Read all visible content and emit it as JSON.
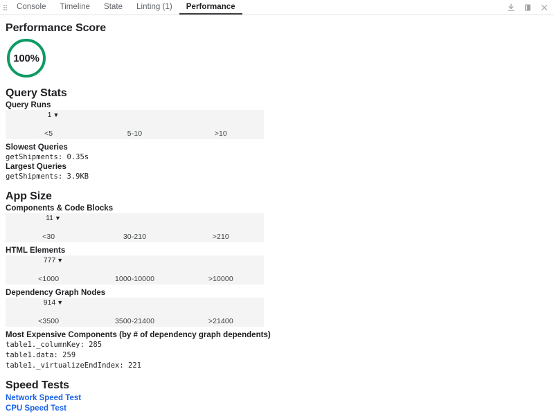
{
  "toolbar": {
    "drag_handle_icon": "drag-dots-icon",
    "tabs": [
      {
        "label": "Console",
        "active": false
      },
      {
        "label": "Timeline",
        "active": false
      },
      {
        "label": "State",
        "active": false
      },
      {
        "label": "Linting (1)",
        "active": false
      },
      {
        "label": "Performance",
        "active": true
      }
    ],
    "actions": [
      {
        "name": "download-icon",
        "title": "Download"
      },
      {
        "name": "dock-panel-icon",
        "title": "Dock panel"
      },
      {
        "name": "close-icon",
        "title": "Close"
      }
    ]
  },
  "performance_score": {
    "heading": "Performance Score",
    "value": "100%",
    "ring_color": "#0c9b63"
  },
  "query_stats": {
    "heading": "Query Stats",
    "gauge": {
      "label": "Query Runs",
      "marker_value": "1",
      "marker_percent": 18.5,
      "ranges": [
        "<5",
        "5-10",
        ">10"
      ]
    },
    "slowest_queries": {
      "label": "Slowest Queries",
      "items": [
        "getShipments: 0.35s"
      ]
    },
    "largest_queries": {
      "label": "Largest Queries",
      "items": [
        "getShipments: 3.9KB"
      ]
    }
  },
  "app_size": {
    "heading": "App Size",
    "gauges": [
      {
        "label": "Components & Code Blocks",
        "marker_value": "11",
        "marker_percent": 18.5,
        "ranges": [
          "<30",
          "30-210",
          ">210"
        ]
      },
      {
        "label": "HTML Elements",
        "marker_value": "777",
        "marker_percent": 18.5,
        "ranges": [
          "<1000",
          "1000-10000",
          ">10000"
        ]
      },
      {
        "label": "Dependency Graph Nodes",
        "marker_value": "914",
        "marker_percent": 18.5,
        "ranges": [
          "<3500",
          "3500-21400",
          ">21400"
        ]
      }
    ],
    "expensive_components": {
      "label": "Most Expensive Components (by # of dependency graph dependents)",
      "items": [
        "table1._columnKey: 285",
        "table1.data: 259",
        "table1._virtualizeEndIndex: 221"
      ]
    }
  },
  "speed_tests": {
    "heading": "Speed Tests",
    "links": [
      "Network Speed Test",
      "CPU Speed Test"
    ],
    "link_color": "#1a62e8"
  },
  "palette": {
    "good": "#6fe3ae",
    "warn": "#fbe38a",
    "bad": "#f4716f",
    "gauge_bg": "#f4f4f4"
  }
}
